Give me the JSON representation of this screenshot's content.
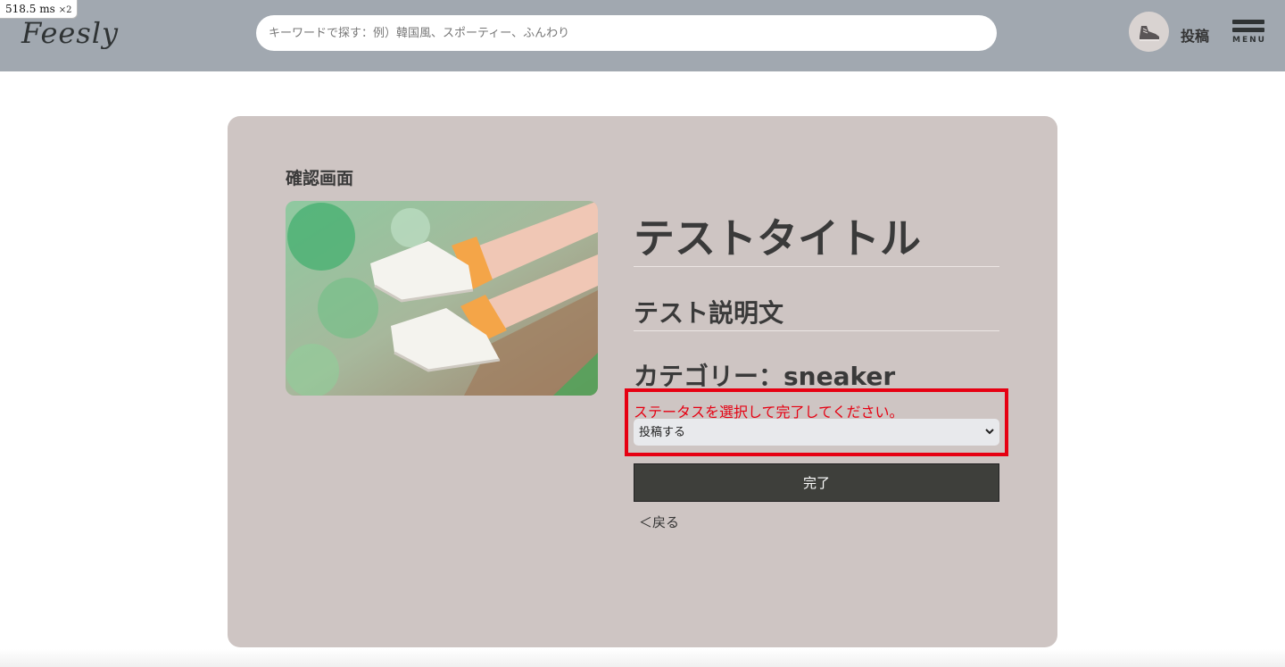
{
  "perf": {
    "value": "518.5",
    "unit": "ms",
    "multiplier": "×2"
  },
  "header": {
    "logo": "Feesly",
    "search_placeholder": "キーワードで探す：例）韓国風、スポーティー、ふんわり",
    "post_label": "投稿",
    "menu_label": "MENU",
    "avatar_icon": "sneaker-avatar-icon",
    "bg_color": "#a1a8b0"
  },
  "confirm": {
    "screen_title": "確認画面",
    "image_icon": "sneakers-photo",
    "post_title": "テストタイトル",
    "description": "テスト説明文",
    "category": "カテゴリー：sneaker",
    "error_message": "ステータスを選択して完了してください。",
    "status_selected": "投稿する",
    "submit_label": "完了",
    "back_label": "＜戻る",
    "card_color": "#cec5c3",
    "error_color": "#e60012",
    "button_color": "#3e3f3b"
  }
}
